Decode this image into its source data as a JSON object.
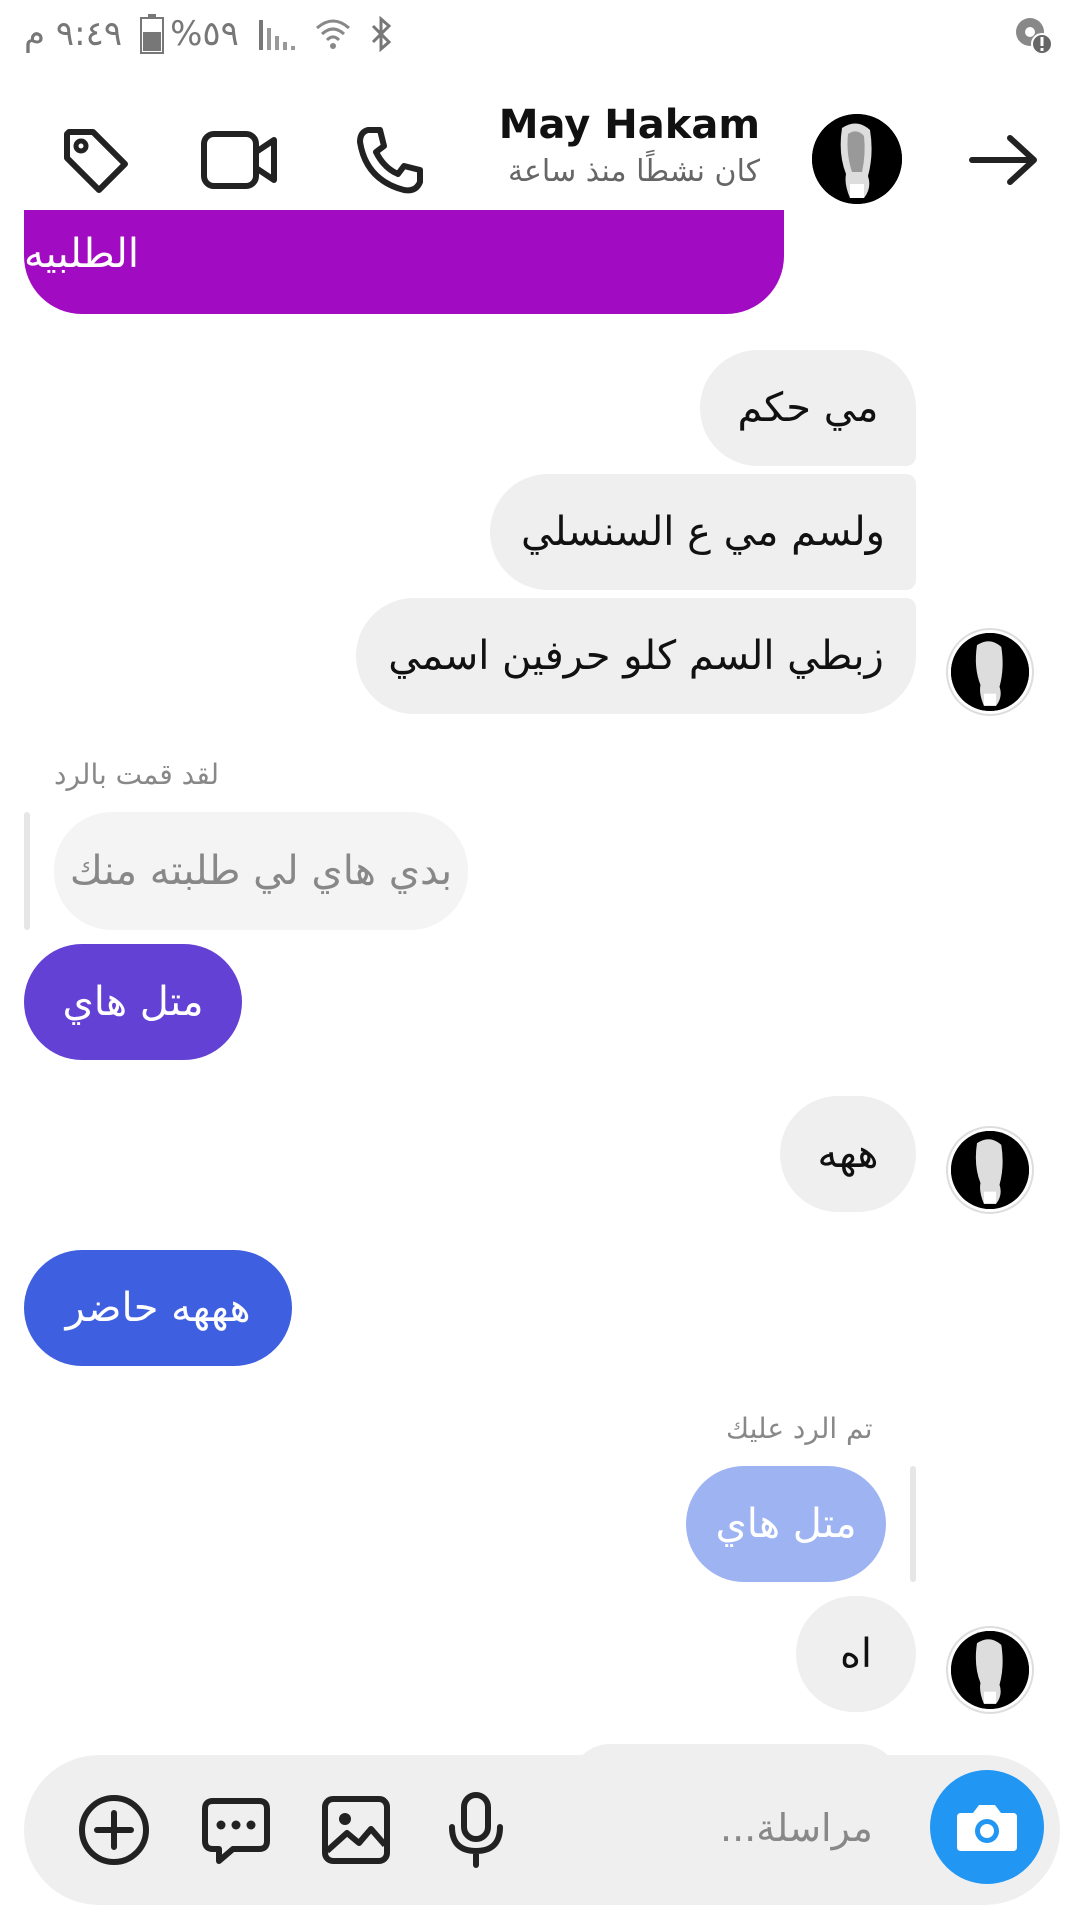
{
  "status_bar": {
    "time": "٩:٤٩ م",
    "battery": "%٥٩"
  },
  "header": {
    "name": "May Hakam",
    "status": "كان نشطًا منذ ساعة"
  },
  "messages": [
    {
      "text": "الطلبيه"
    },
    {
      "text": "مي حكم"
    },
    {
      "text": "ولسم مي ع السنسلي"
    },
    {
      "text": "زبطي السم كلو حرفين اسمي"
    },
    {
      "text": "لقد قمت بالرد"
    },
    {
      "text": "بدي هاي لي طلبته منك"
    },
    {
      "text": "متل هاي"
    },
    {
      "text": "ههه"
    },
    {
      "text": "هههه حاضر"
    },
    {
      "text": "تم الرد عليك"
    },
    {
      "text": "متل هاي"
    },
    {
      "text": "اه"
    }
  ],
  "composer": {
    "placeholder": "مراسلة..."
  },
  "colors": {
    "purple_bubble": "#a10bc1",
    "violet_bubble": "#6441d5",
    "blue_bubble": "#3e5fe0",
    "quoted_bubble": "#9eb4f2",
    "camera": "#2196f3"
  }
}
